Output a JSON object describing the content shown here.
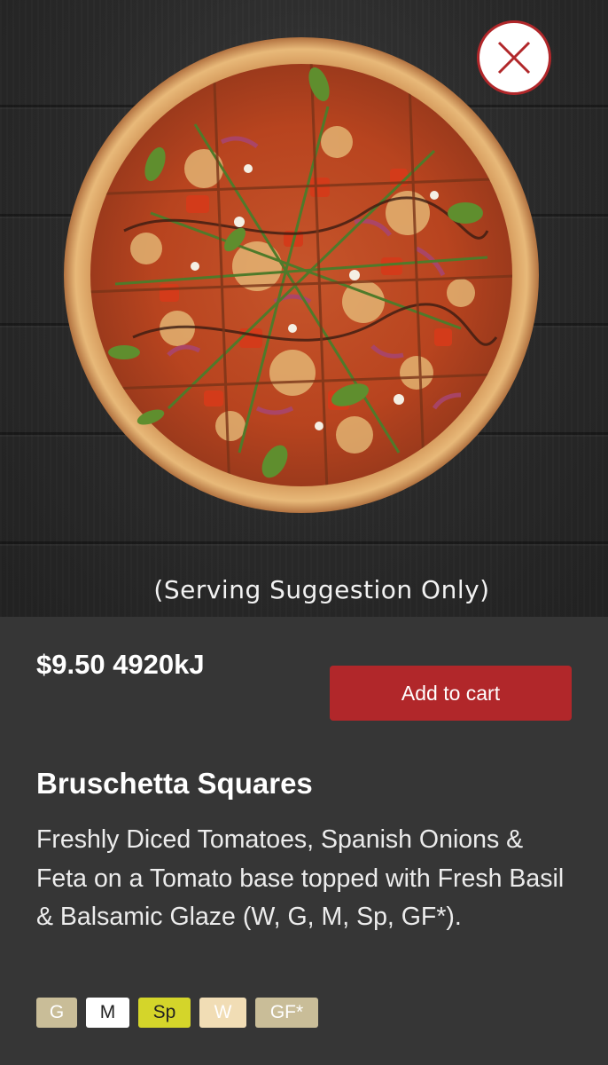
{
  "hero": {
    "note": "(Serving Suggestion Only)"
  },
  "close_icon": "close-x-icon",
  "product": {
    "price": "$9.50",
    "energy": "4920kJ",
    "price_line": "$9.50 4920kJ",
    "title": "Bruschetta Squares",
    "description": "Freshly Diced Tomatoes, Spanish Onions & Feta on a Tomato base topped with Fresh Basil & Balsamic Glaze (W, G, M, Sp, GF*).",
    "add_to_cart_label": "Add to cart"
  },
  "badges": [
    {
      "label": "G",
      "bg": "#c9bd98",
      "fg": "#ffffff"
    },
    {
      "label": "M",
      "bg": "#ffffff",
      "fg": "#222222"
    },
    {
      "label": "Sp",
      "bg": "#d4d52a",
      "fg": "#222222"
    },
    {
      "label": "W",
      "bg": "#f1ddb5",
      "fg": "#ffffff"
    },
    {
      "label": "GF*",
      "bg": "#c9bd98",
      "fg": "#ffffff"
    }
  ],
  "colors": {
    "accent": "#b1272a",
    "background": "#363636"
  }
}
